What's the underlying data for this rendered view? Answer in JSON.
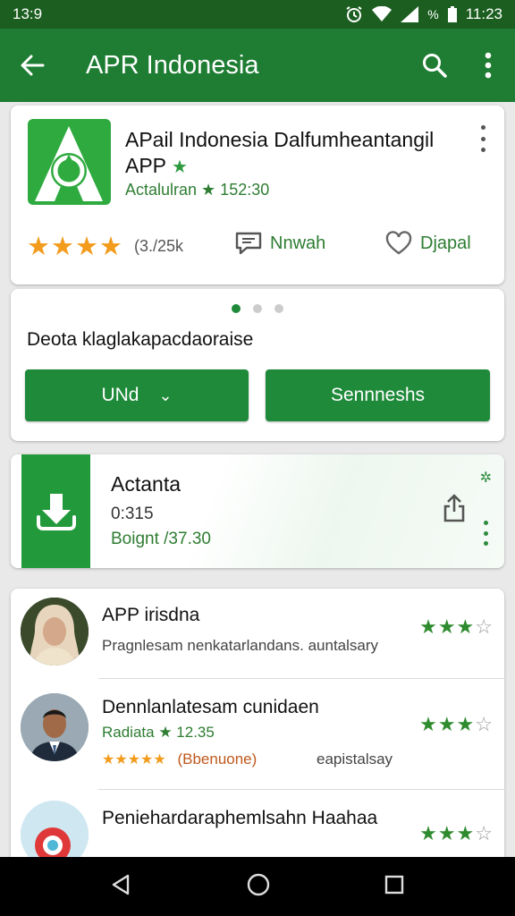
{
  "status_bar": {
    "time_left": "13:9",
    "time_right": "11:23",
    "battery_text": "%"
  },
  "app_bar": {
    "title": "APR Indonesia"
  },
  "app_card": {
    "name_line1": "APail Indonesia Dalfumheantangil",
    "name_line2": "APP",
    "meta": "Actalulran ★ 152:30",
    "stars": "★★★★",
    "rating_count": "(3./25k",
    "action1_label": "Nnwah",
    "action2_label": "Djapal"
  },
  "promo_card": {
    "text": "Deota klaglakapacdaoraise",
    "button1_label": "UNd",
    "button2_label": "Sennneshs",
    "pager_active": 0,
    "pager_count": 3
  },
  "download_card": {
    "title": "Actanta",
    "time": "0:315",
    "status": "Boignt /37.30"
  },
  "reviews": [
    {
      "title": "APP irisdna",
      "subtitle": "Pragnlesam nenkatarlandans. auntalsary",
      "rating": 3,
      "max": 4
    },
    {
      "title": "Dennlanlatesam cunidaen",
      "meta": "Radiata ★ 12.35",
      "small_stars": "★★★★★",
      "tag": "(Bbenuone)",
      "right_text": "eapistalsay",
      "rating": 3,
      "max": 4
    },
    {
      "title": "Peniehardaraphemlsahn Haahaa",
      "rating": 3,
      "max": 4
    }
  ],
  "colors": {
    "primary": "#1e7d32",
    "status_bar": "#1b5e20",
    "star_orange": "#f29b1d",
    "star_green": "#2e8b2e"
  }
}
